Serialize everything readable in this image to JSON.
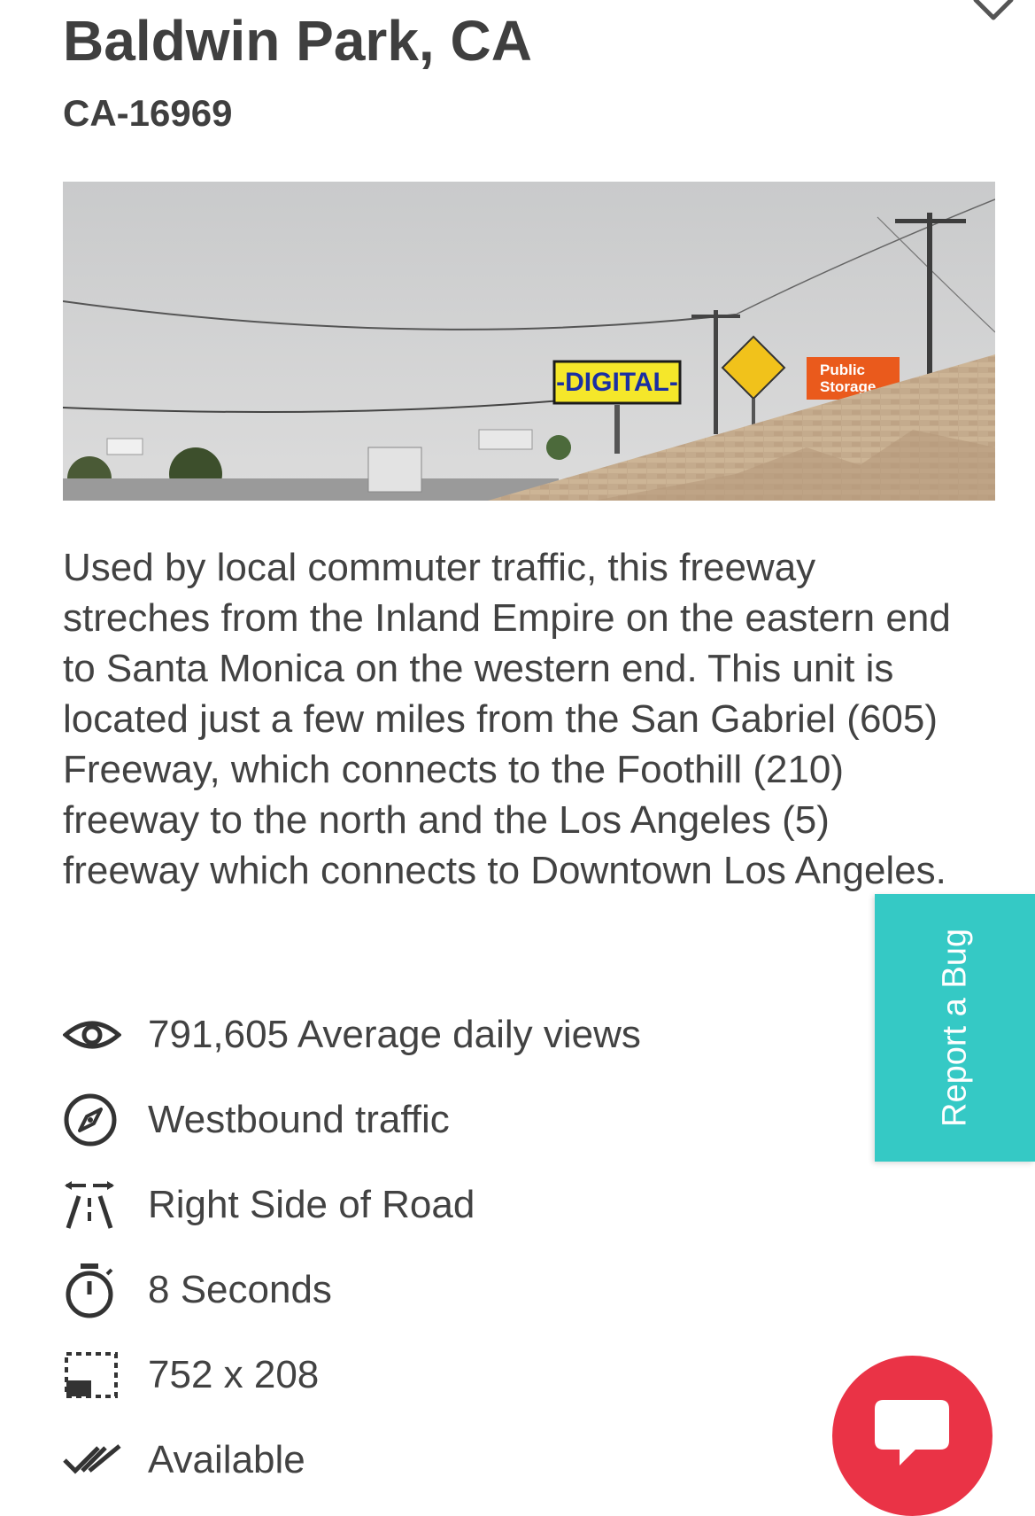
{
  "listing": {
    "title": "Baldwin Park, CA",
    "code": "CA-16969",
    "description": "Used by local commuter traffic, this freeway streches from the Inland Empire on the eastern end to Santa Monica on the western end. This unit is located just a few miles from the San Gabriel (605) Freeway, which connects to the Foothill (210) freeway to the north and the Los Angeles (5) freeway which connects to Downtown Los Angeles."
  },
  "photo": {
    "billboard_text": "-DIGITAL-",
    "sign_text": "Public Storage"
  },
  "details": [
    {
      "icon": "eye-icon",
      "text": "791,605 Average daily views"
    },
    {
      "icon": "compass-icon",
      "text": "Westbound traffic"
    },
    {
      "icon": "road-side-icon",
      "text": "Right Side of Road"
    },
    {
      "icon": "stopwatch-icon",
      "text": "8 Seconds"
    },
    {
      "icon": "dimensions-icon",
      "text": "752 x 208"
    },
    {
      "icon": "double-check-icon",
      "text": "Available"
    }
  ],
  "report_bug": {
    "label": "Report a Bug"
  },
  "colors": {
    "report_tab": "#35c9c5",
    "chat_button": "#ea3346",
    "text": "#424242"
  }
}
